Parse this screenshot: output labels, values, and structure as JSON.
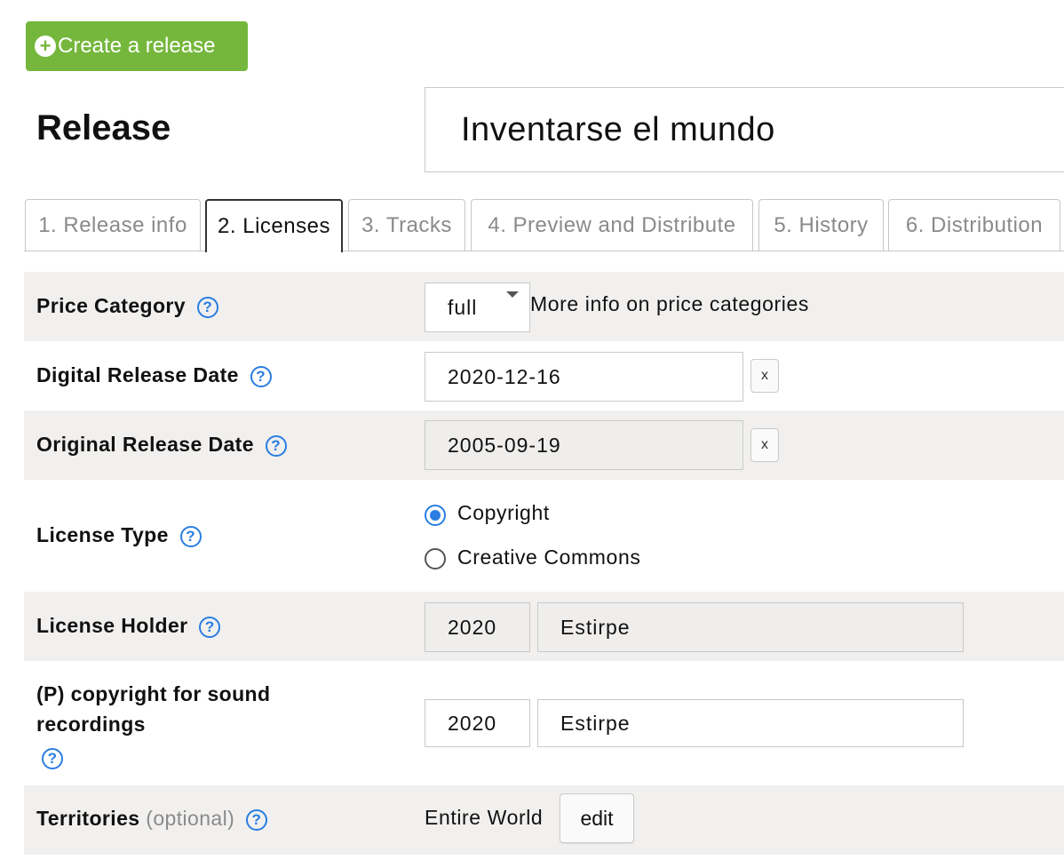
{
  "create_button": {
    "label": "Create a release",
    "icon": "plus-circle-icon"
  },
  "page": {
    "label": "Release",
    "release_title": "Inventarse el mundo"
  },
  "tabs": [
    {
      "label": "1. Release info"
    },
    {
      "label": "2. Licenses",
      "active": true
    },
    {
      "label": "3. Tracks"
    },
    {
      "label": "4. Preview and Distribute"
    },
    {
      "label": "5. History"
    },
    {
      "label": "6. Distribution"
    }
  ],
  "form": {
    "price_category": {
      "label": "Price Category",
      "value": "full",
      "more_info": "More info on price categories"
    },
    "digital_release_date": {
      "label": "Digital Release Date",
      "value": "2020-12-16",
      "clear": "x"
    },
    "original_release_date": {
      "label": "Original Release Date",
      "value": "2005-09-19",
      "clear": "x"
    },
    "license_type": {
      "label": "License Type",
      "options": [
        "Copyright",
        "Creative Commons"
      ],
      "selected": "Copyright"
    },
    "license_holder": {
      "label": "License Holder",
      "year": "2020",
      "holder": "Estirpe"
    },
    "p_copyright": {
      "label": "(P) copyright for sound recordings",
      "year": "2020",
      "holder": "Estirpe"
    },
    "territories": {
      "label": "Territories",
      "optional": "(optional)",
      "value": "Entire World",
      "edit": "edit"
    }
  },
  "help_glyph": "?",
  "colors": {
    "green": "#75b73c",
    "blue": "#2a7de1",
    "row_gray": "#f1f0ef"
  }
}
